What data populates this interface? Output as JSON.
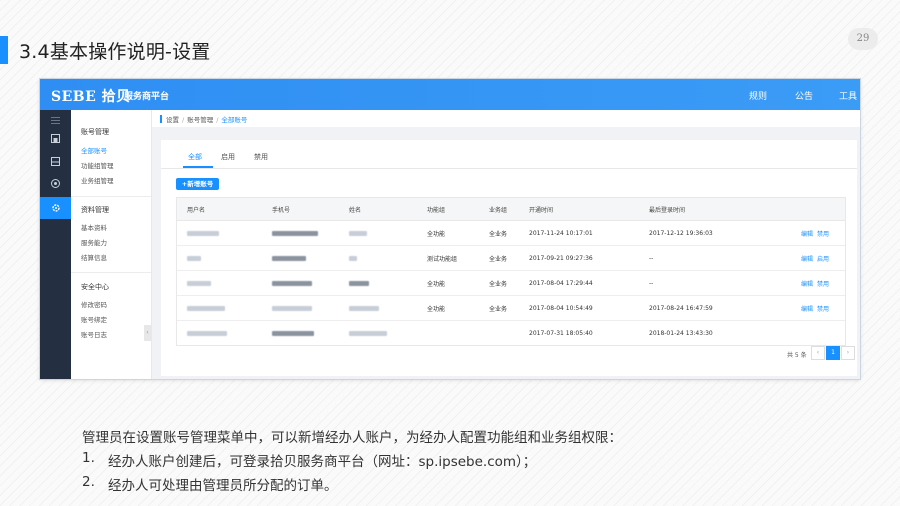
{
  "slide": {
    "title": "3.4基本操作说明-设置",
    "page_number": "29",
    "accent_color": "#1890ff"
  },
  "app": {
    "brand": "SEBE 拾贝",
    "brand_sub": "服务商平台",
    "topnav": [
      "规则",
      "公告",
      "工具"
    ],
    "brand_color": "#2f8ef3"
  },
  "sidebar_icons": [
    "menu-icon",
    "store-icon",
    "inbox-icon",
    "compass-icon",
    "gear-icon"
  ],
  "submenu": {
    "groups": [
      {
        "title": "账号管理",
        "items": [
          "全部账号",
          "功能组管理",
          "业务组管理"
        ]
      },
      {
        "title": "资料管理",
        "items": [
          "基本资料",
          "服务能力",
          "结算信息"
        ]
      },
      {
        "title": "安全中心",
        "items": [
          "修改密码",
          "账号绑定",
          "账号日志"
        ]
      }
    ],
    "active_item": "全部账号",
    "collapse_glyph": "‹"
  },
  "breadcrumb": {
    "items": [
      "设置",
      "账号管理",
      "全部账号"
    ],
    "separator": "/"
  },
  "tabs": [
    "全部",
    "启用",
    "禁用"
  ],
  "add_button": "+新增账号",
  "table": {
    "headers": [
      "用户名",
      "手机号",
      "姓名",
      "功能组",
      "业务组",
      "开通时间",
      "最后登录时间",
      ""
    ],
    "rows": [
      {
        "function_group": "全功能",
        "business_group": "全业务",
        "opened": "2017-11-24 10:17:01",
        "last_login": "2017-12-12 19:36:03",
        "actions": [
          "编辑",
          "禁用"
        ]
      },
      {
        "function_group": "测试功能组",
        "business_group": "全业务",
        "opened": "2017-09-21 09:27:36",
        "last_login": "--",
        "actions": [
          "编辑",
          "启用"
        ]
      },
      {
        "function_group": "全功能",
        "business_group": "全业务",
        "opened": "2017-08-04 17:29:44",
        "last_login": "--",
        "actions": [
          "编辑",
          "禁用"
        ]
      },
      {
        "function_group": "全功能",
        "business_group": "全业务",
        "opened": "2017-08-04 10:54:49",
        "last_login": "2017-08-24 16:47:59",
        "actions": [
          "编辑",
          "禁用"
        ]
      },
      {
        "function_group": "",
        "business_group": "",
        "opened": "2017-07-31 18:05:40",
        "last_login": "2018-01-24 13:43:30",
        "actions": []
      }
    ]
  },
  "pagination": {
    "total_label": "共 5 条",
    "prev_glyph": "‹",
    "next_glyph": "›",
    "current_page": "1"
  },
  "description": {
    "intro": "管理员在设置账号管理菜单中，可以新增经办人账户，为经办人配置功能组和业务组权限：",
    "points": [
      {
        "num": "1.",
        "text": "经办人账户创建后，可登录拾贝服务商平台（网址：sp.ipsebe.com）；"
      },
      {
        "num": "2.",
        "text": "经办人可处理由管理员所分配的订单。"
      }
    ]
  }
}
